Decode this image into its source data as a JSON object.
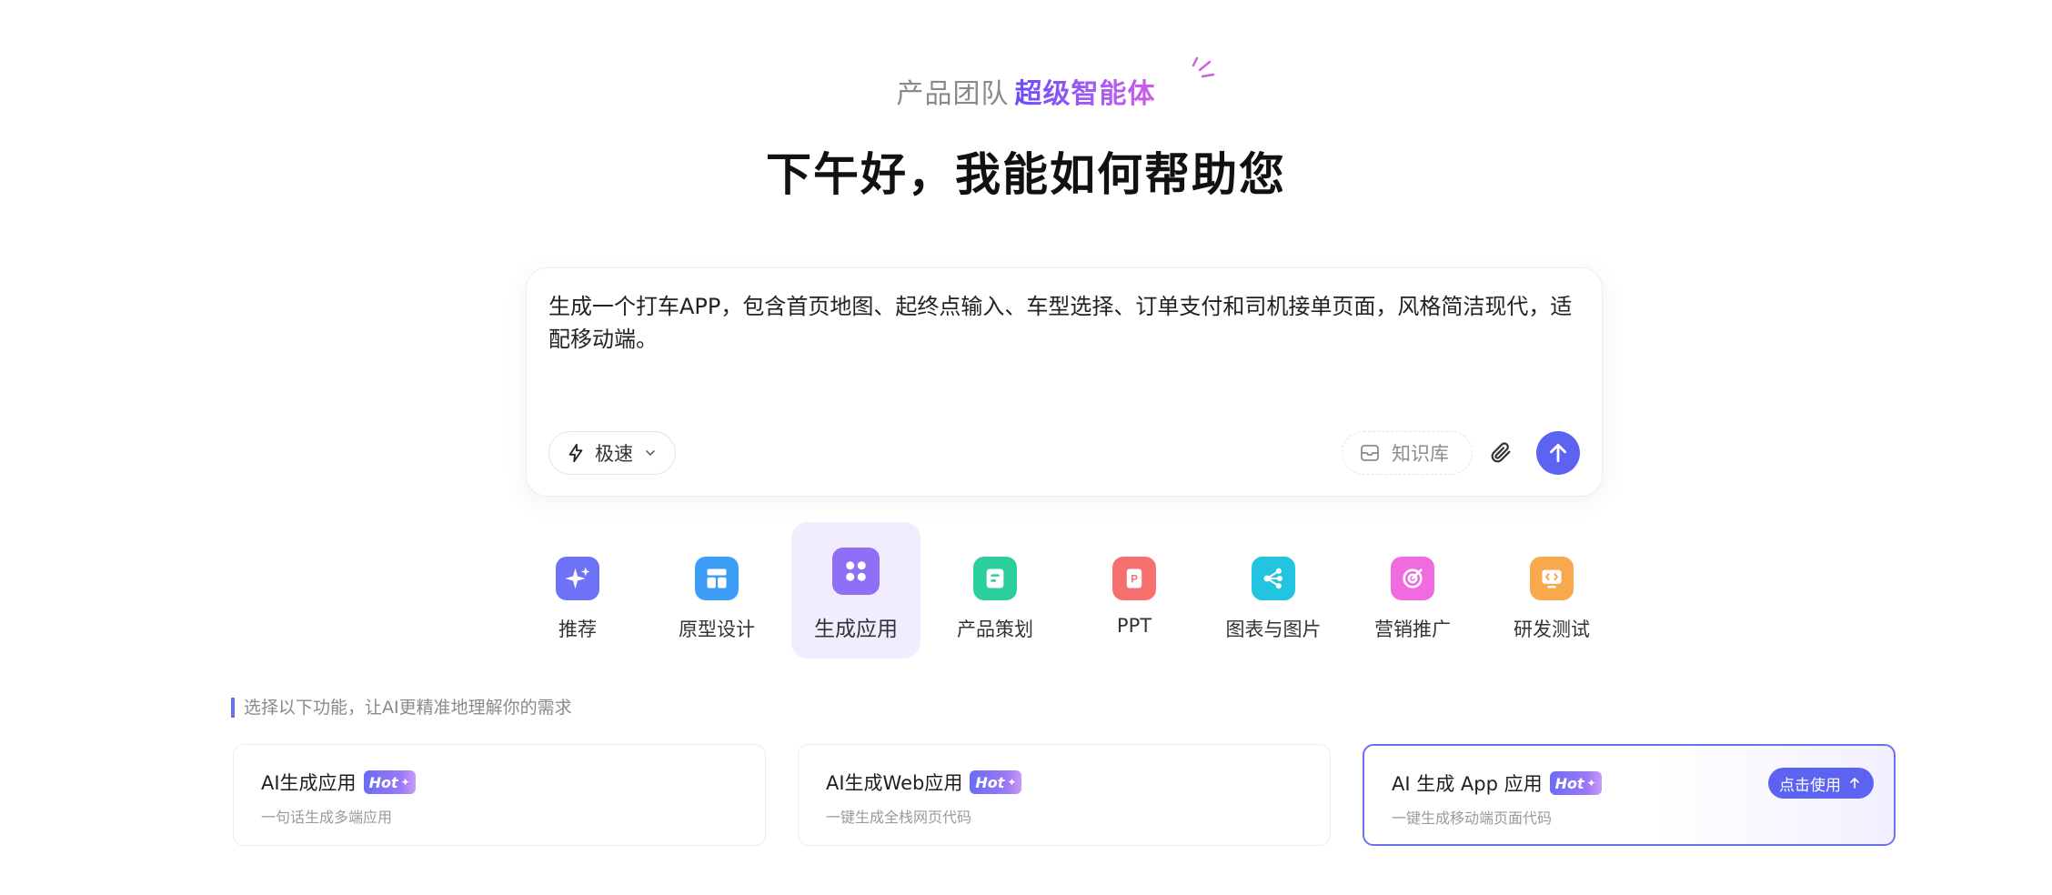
{
  "header": {
    "team": "产品团队",
    "super_agent": "超级智能体",
    "greeting": "下午好，我能如何帮助您"
  },
  "composer": {
    "prompt": "生成一个打车APP，包含首页地图、起终点输入、车型选择、订单支付和司机接单页面，风格简洁现代，适配移动端。",
    "mode_label": "极速",
    "knowledge_label": "知识库"
  },
  "categories": [
    {
      "label": "推荐",
      "icon": "sparkle-icon",
      "color": "#6e72f7"
    },
    {
      "label": "原型设计",
      "icon": "layout-icon",
      "color": "#3d9cf6"
    },
    {
      "label": "生成应用",
      "icon": "apps-grid-icon",
      "color": "#8f6ff5"
    },
    {
      "label": "产品策划",
      "icon": "document-icon",
      "color": "#2bcf9c"
    },
    {
      "label": "PPT",
      "icon": "ppt-icon",
      "color": "#f76f6f"
    },
    {
      "label": "图表与图片",
      "icon": "share-nodes-icon",
      "color": "#22c4e0"
    },
    {
      "label": "营销推广",
      "icon": "target-icon",
      "color": "#f06be0"
    },
    {
      "label": "研发测试",
      "icon": "code-icon",
      "color": "#f8a94e"
    }
  ],
  "section_label": "选择以下功能，让AI更精准地理解你的需求",
  "features": [
    {
      "title": "AI生成应用",
      "hot": "Hot",
      "desc": "一句话生成多端应用"
    },
    {
      "title": "AI生成Web应用",
      "hot": "Hot",
      "desc": "一键生成全栈网页代码"
    },
    {
      "title": "AI 生成 App 应用",
      "hot": "Hot",
      "desc": "一键生成移动端页面代码",
      "action": "点击使用"
    }
  ],
  "colors": {
    "accent": "#5b63f0",
    "active_tab_bg": "#f1edff"
  }
}
